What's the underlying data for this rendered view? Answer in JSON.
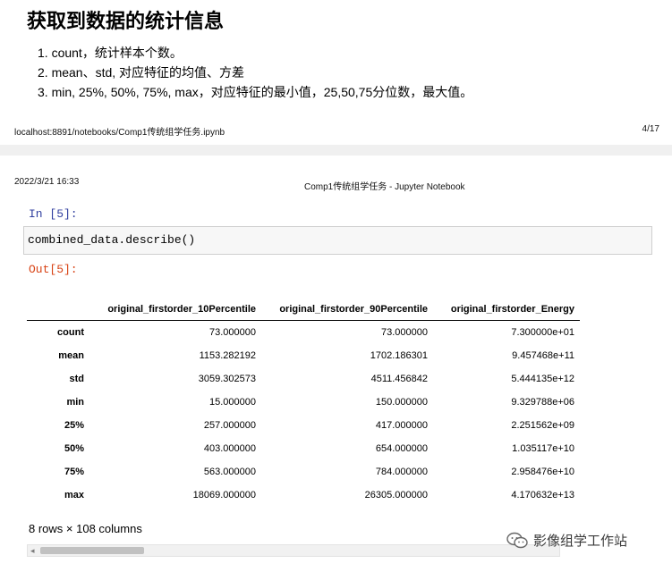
{
  "page1": {
    "heading": "获取到数据的统计信息",
    "list_items": [
      "1. count，统计样本个数。",
      "2. mean、std, 对应特征的均值、方差",
      "3. min, 25%, 50%, 75%, max，对应特征的最小值，25,50,75分位数，最大值。"
    ],
    "footer_url": "localhost:8891/notebooks/Comp1传统组学任务.ipynb",
    "footer_page": "4/17"
  },
  "page2": {
    "header_date": "2022/3/21 16:33",
    "header_title": "Comp1传统组学任务 - Jupyter Notebook"
  },
  "cell": {
    "in_prompt": "In  [5]:",
    "code": "combined_data.describe()",
    "out_prompt": "Out[5]:"
  },
  "table": {
    "columns": [
      "original_firstorder_10Percentile",
      "original_firstorder_90Percentile",
      "original_firstorder_Energy"
    ],
    "rows": [
      {
        "label": "count",
        "values": [
          "73.000000",
          "73.000000",
          "7.300000e+01"
        ]
      },
      {
        "label": "mean",
        "values": [
          "1153.282192",
          "1702.186301",
          "9.457468e+11"
        ]
      },
      {
        "label": "std",
        "values": [
          "3059.302573",
          "4511.456842",
          "5.444135e+12"
        ]
      },
      {
        "label": "min",
        "values": [
          "15.000000",
          "150.000000",
          "9.329788e+06"
        ]
      },
      {
        "label": "25%",
        "values": [
          "257.000000",
          "417.000000",
          "2.251562e+09"
        ]
      },
      {
        "label": "50%",
        "values": [
          "403.000000",
          "654.000000",
          "1.035117e+10"
        ]
      },
      {
        "label": "75%",
        "values": [
          "563.000000",
          "784.000000",
          "2.958476e+10"
        ]
      },
      {
        "label": "max",
        "values": [
          "18069.000000",
          "26305.000000",
          "4.170632e+13"
        ]
      }
    ],
    "shape_text": "8 rows × 108 columns"
  },
  "scrollbar": {
    "left_arrow": "◂"
  },
  "watermark": {
    "text": "影像组学工作站",
    "icon": "wechat-icon"
  },
  "colors": {
    "in_prompt": "#303f9f",
    "out_prompt": "#d84315",
    "page_gap": "#f0f0f0"
  }
}
